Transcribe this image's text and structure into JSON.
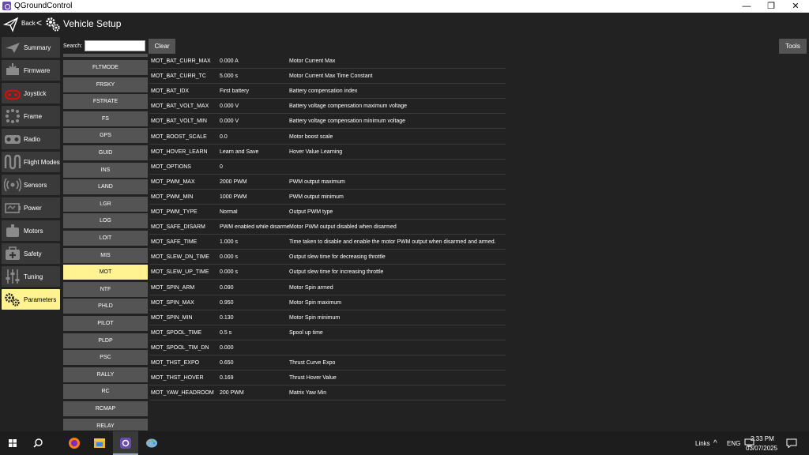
{
  "window": {
    "title": "QGroundControl",
    "minimize": "—",
    "maximize": "❐",
    "close": "✕"
  },
  "header": {
    "back_label": "Back",
    "separator": "<",
    "title": "Vehicle Setup",
    "tools_label": "Tools"
  },
  "sidebar": {
    "items": [
      {
        "label": "Summary",
        "icon": "plane-icon"
      },
      {
        "label": "Firmware",
        "icon": "firmware-icon"
      },
      {
        "label": "Joystick",
        "icon": "joystick-icon"
      },
      {
        "label": "Frame",
        "icon": "frame-icon"
      },
      {
        "label": "Radio",
        "icon": "radio-icon"
      },
      {
        "label": "Flight Modes",
        "icon": "flight-modes-icon"
      },
      {
        "label": "Sensors",
        "icon": "sensors-icon"
      },
      {
        "label": "Power",
        "icon": "power-icon"
      },
      {
        "label": "Motors",
        "icon": "motors-icon"
      },
      {
        "label": "Safety",
        "icon": "safety-icon"
      },
      {
        "label": "Tuning",
        "icon": "tuning-icon"
      },
      {
        "label": "Parameters",
        "icon": "gears-icon",
        "active": true
      }
    ]
  },
  "search": {
    "label": "Search:",
    "value": "",
    "clear_label": "Clear"
  },
  "groups": [
    "FLTMODE",
    "FRSKY",
    "FSTRATE",
    "FS",
    "GPS",
    "GUID",
    "INS",
    "LAND",
    "LGR",
    "LOG",
    "LOIT",
    "MIS",
    "MOT",
    "NTF",
    "PHLD",
    "PILOT",
    "PLDP",
    "PSC",
    "RALLY",
    "RC",
    "RCMAP",
    "RELAY"
  ],
  "active_group": "MOT",
  "params": [
    {
      "name": "MOT_BAT_CURR_MAX",
      "value": "0.000 A",
      "desc": "Motor Current Max"
    },
    {
      "name": "MOT_BAT_CURR_TC",
      "value": "5.000 s",
      "desc": "Motor Current Max Time Constant"
    },
    {
      "name": "MOT_BAT_IDX",
      "value": "First battery",
      "desc": "Battery compensation index"
    },
    {
      "name": "MOT_BAT_VOLT_MAX",
      "value": "0.000 V",
      "desc": "Battery voltage compensation maximum voltage"
    },
    {
      "name": "MOT_BAT_VOLT_MIN",
      "value": "0.000 V",
      "desc": "Battery voltage compensation minimum voltage"
    },
    {
      "name": "MOT_BOOST_SCALE",
      "value": "0.0",
      "desc": "Motor boost scale"
    },
    {
      "name": "MOT_HOVER_LEARN",
      "value": "Learn and Save",
      "desc": "Hover Value Learning"
    },
    {
      "name": "MOT_OPTIONS",
      "value": "0",
      "desc": ""
    },
    {
      "name": "MOT_PWM_MAX",
      "value": "2000 PWM",
      "desc": "PWM output maximum"
    },
    {
      "name": "MOT_PWM_MIN",
      "value": "1000 PWM",
      "desc": "PWM output minimum"
    },
    {
      "name": "MOT_PWM_TYPE",
      "value": "Normal",
      "desc": "Output PWM type"
    },
    {
      "name": "MOT_SAFE_DISARM",
      "value": "PWM enabled while disarmed",
      "desc": "Motor PWM output disabled when disarmed"
    },
    {
      "name": "MOT_SAFE_TIME",
      "value": "1.000 s",
      "desc": "Time taken to disable and enable the motor PWM output when disarmed and armed."
    },
    {
      "name": "MOT_SLEW_DN_TIME",
      "value": "0.000 s",
      "desc": "Output slew time for decreasing throttle"
    },
    {
      "name": "MOT_SLEW_UP_TIME",
      "value": "0.000 s",
      "desc": "Output slew time for increasing throttle"
    },
    {
      "name": "MOT_SPIN_ARM",
      "value": "0.090",
      "desc": "Motor Spin armed"
    },
    {
      "name": "MOT_SPIN_MAX",
      "value": "0.950",
      "desc": "Motor Spin maximum"
    },
    {
      "name": "MOT_SPIN_MIN",
      "value": "0.130",
      "desc": "Motor Spin minimum"
    },
    {
      "name": "MOT_SPOOL_TIME",
      "value": "0.5 s",
      "desc": "Spool up time"
    },
    {
      "name": "MOT_SPOOL_TIM_DN",
      "value": "0.000",
      "desc": ""
    },
    {
      "name": "MOT_THST_EXPO",
      "value": "0.650",
      "desc": "Thrust Curve Expo"
    },
    {
      "name": "MOT_THST_HOVER",
      "value": "0.169",
      "desc": "Thrust Hover Value"
    },
    {
      "name": "MOT_YAW_HEADROOM",
      "value": "200 PWM",
      "desc": "Matrix Yaw Min"
    }
  ],
  "taskbar": {
    "links_label": "Links",
    "chevron": "^",
    "language": "ENG",
    "time": "2:33 PM",
    "date": "03/07/2025"
  }
}
